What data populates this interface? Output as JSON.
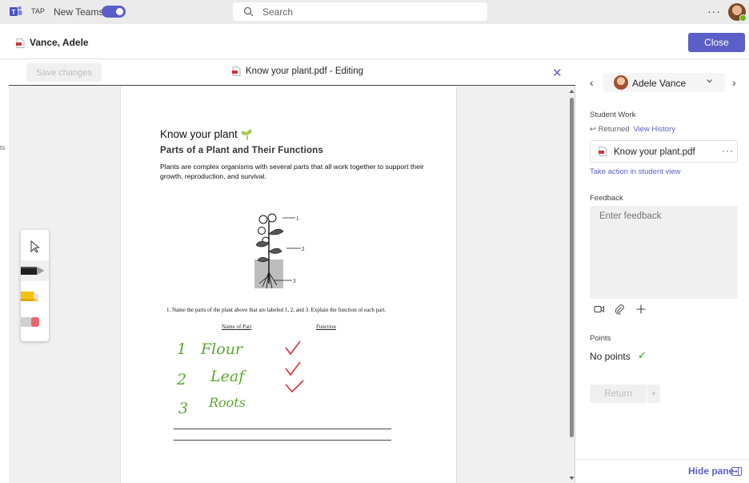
{
  "topbar": {
    "org_label": "TAP",
    "new_teams_label": "New Teams",
    "new_teams_enabled": true,
    "search_placeholder": "Search",
    "more_label": "···"
  },
  "header": {
    "student_name": "Vance, Adele",
    "close_label": "Close"
  },
  "sidebar": {
    "clipped_text": "ts"
  },
  "editor": {
    "save_label": "Save changes",
    "doc_title": "Know your plant.pdf - Editing",
    "close_glyph": "✕"
  },
  "document": {
    "heading": "Know your plant",
    "heading_emoji": "🌱",
    "subheading": "Parts of a Plant and Their Functions",
    "body": "Plants are complex organisms with several parts that all work together to support their growth, reproduction, and survival.",
    "diagram_labels": [
      "1",
      "2",
      "3"
    ],
    "question": "1. Name the parts of the plant above that are labeled 1, 2, and 3. Explain the function of each part.",
    "col_part": "Name of Part",
    "col_function": "Function",
    "handwritten_answers": [
      {
        "num": "1",
        "text": "Flour"
      },
      {
        "num": "2",
        "text": "Leaf"
      },
      {
        "num": "3",
        "text": "Roots"
      }
    ]
  },
  "tools": [
    "select-tool",
    "black-pen",
    "yellow-highlighter",
    "eraser"
  ],
  "pane": {
    "student": "Adele Vance",
    "student_work_label": "Student Work",
    "returned_label": "Returned",
    "view_history_label": "View History",
    "file_name": "Know your plant.pdf",
    "file_more": "···",
    "take_action_label": "Take action in student view",
    "feedback_label": "Feedback",
    "feedback_placeholder": "Enter feedback",
    "points_label": "Points",
    "points_value": "No points",
    "return_label": "Return",
    "hide_pane_label": "Hide pane"
  },
  "colors": {
    "brand": "#5b5fc7",
    "ink_green": "#5aa832",
    "check_red": "#e0303a"
  }
}
